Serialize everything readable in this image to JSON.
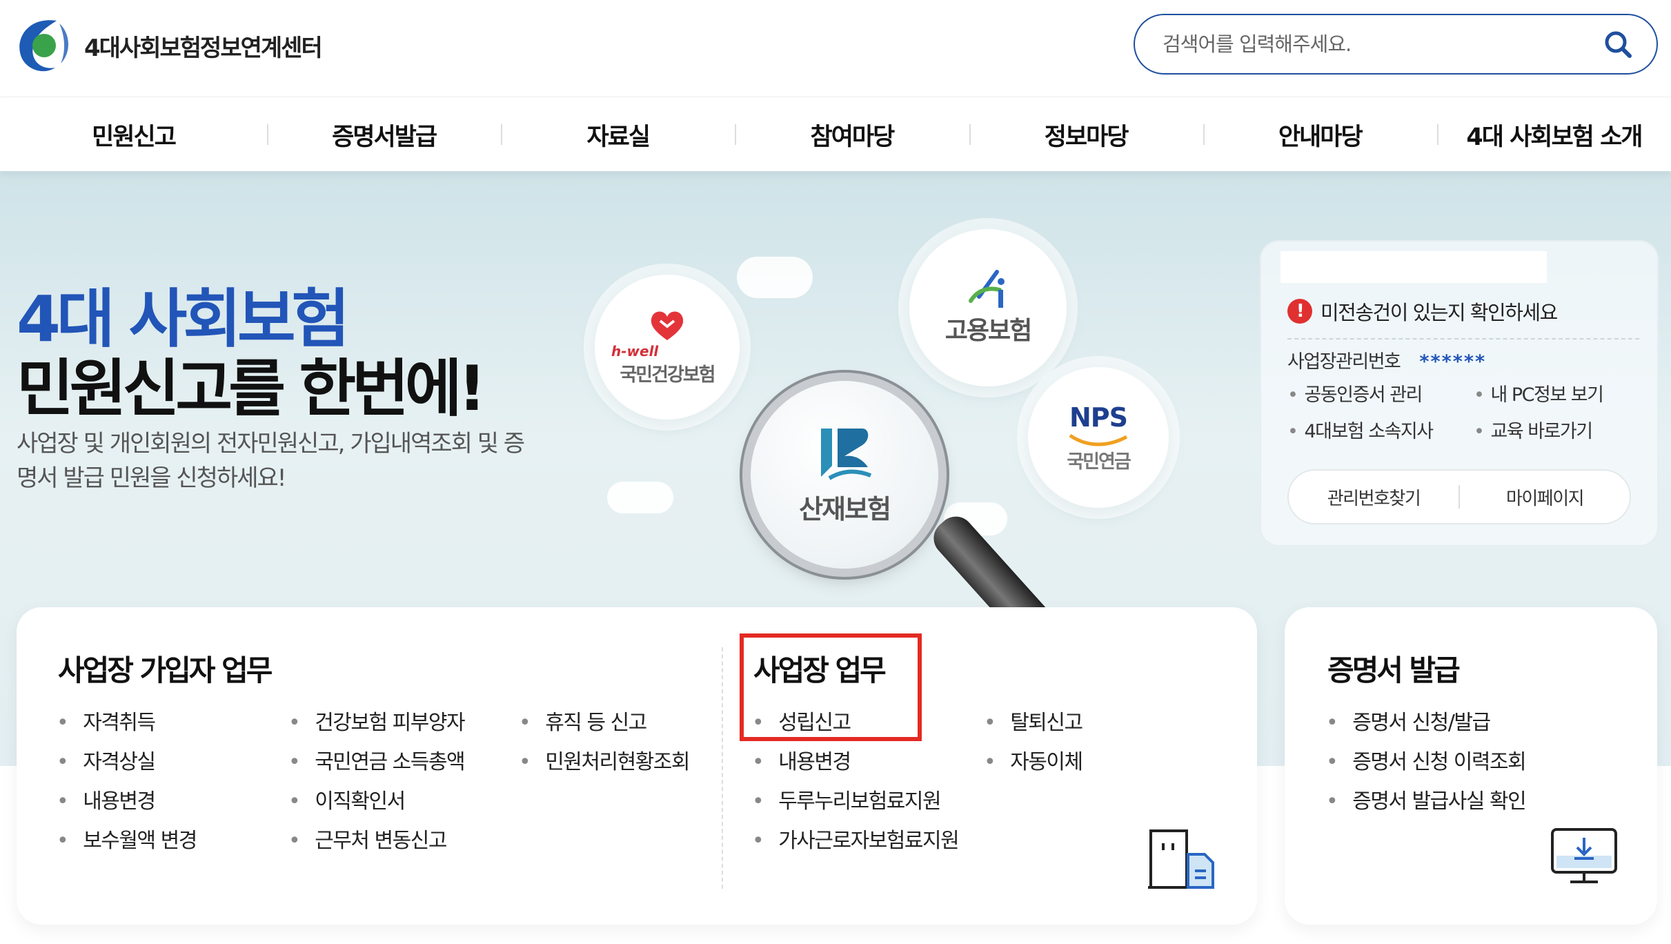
{
  "header": {
    "logo_text": "4대사회보험정보연계센터",
    "search_placeholder": "검색어를 입력해주세요."
  },
  "nav": [
    "민원신고",
    "증명서발급",
    "자료실",
    "참여마당",
    "정보마당",
    "안내마당",
    "4대 사회보험 소개"
  ],
  "hero": {
    "title_line1": "4대 사회보험",
    "title_line2": "민원신고를 한번에!",
    "desc": "사업장 및 개인회원의 전자민원신고, 가입내역조회 및 증명서 발급 민원을 신청하세요!",
    "bubbles": {
      "health_brand": "h-well",
      "health": "국민건강보험",
      "employment": "고용보험",
      "nps_brand": "NPS",
      "nps": "국민연금",
      "sanjae": "산재보험"
    }
  },
  "side": {
    "warning": "미전송건이 있는지 확인하세요",
    "mgmt_label": "사업장관리번호",
    "mgmt_value": "******",
    "links": [
      "공동인증서 관리",
      "내 PC정보 보기",
      "4대보험 소속지사",
      "교육 바로가기"
    ],
    "btn_find": "관리번호찾기",
    "btn_mypage": "마이페이지"
  },
  "subscriber": {
    "title": "사업장 가입자 업무",
    "col1": [
      "자격취득",
      "자격상실",
      "내용변경",
      "보수월액 변경"
    ],
    "col2": [
      "건강보험 피부양자",
      "국민연금 소득총액",
      "이직확인서",
      "근무처 변동신고"
    ],
    "col3": [
      "휴직 등 신고",
      "민원처리현황조회"
    ]
  },
  "workplace": {
    "title": "사업장 업무",
    "col1": [
      "성립신고",
      "내용변경",
      "두루누리보험료지원",
      "가사근로자보험료지원"
    ],
    "col2": [
      "탈퇴신고",
      "자동이체"
    ]
  },
  "cert": {
    "title": "증명서 발급",
    "items": [
      "증명서 신청/발급",
      "증명서 신청 이력조회",
      "증명서 발급사실 확인"
    ]
  },
  "colors": {
    "brand_blue": "#2255b8",
    "highlight_red": "#e32a23",
    "search_border": "#1f4f9e"
  }
}
